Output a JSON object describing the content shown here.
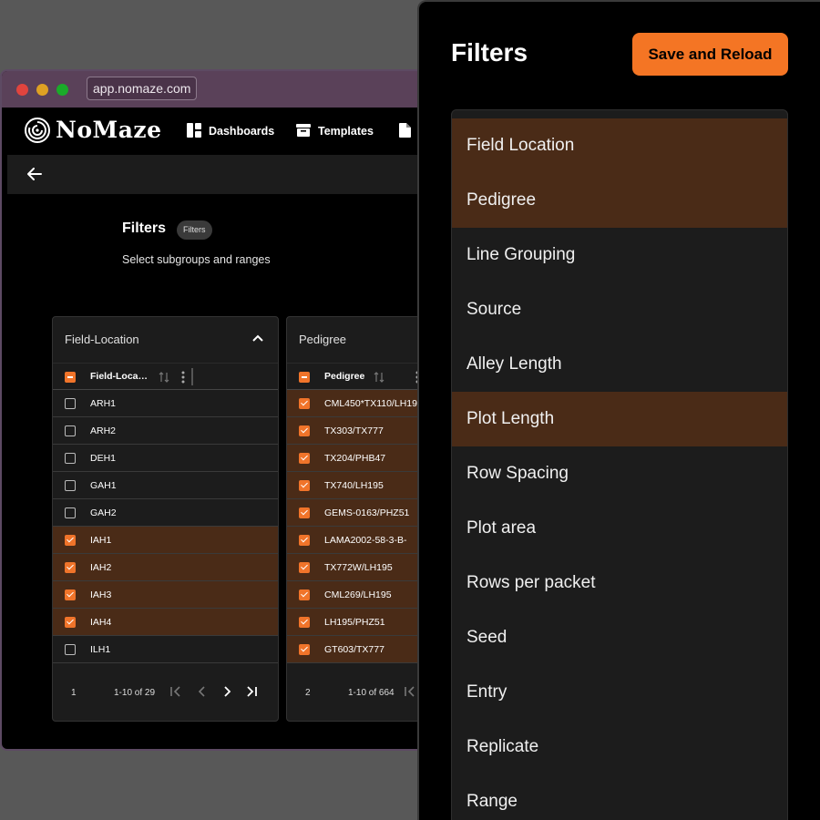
{
  "browser": {
    "url": "app.nomaze.com"
  },
  "app": {
    "brand": "NoMaze",
    "nav": {
      "dashboards": "Dashboards",
      "templates": "Templates"
    }
  },
  "page": {
    "title": "Filters",
    "badge": "Filters",
    "subtitle": "Select subgroups and ranges"
  },
  "cards": [
    {
      "title": "Field-Location",
      "column": "Field-Loca…",
      "rows": [
        {
          "label": "ARH1",
          "checked": false
        },
        {
          "label": "ARH2",
          "checked": false
        },
        {
          "label": "DEH1",
          "checked": false
        },
        {
          "label": "GAH1",
          "checked": false
        },
        {
          "label": "GAH2",
          "checked": false
        },
        {
          "label": "IAH1",
          "checked": true
        },
        {
          "label": "IAH2",
          "checked": true
        },
        {
          "label": "IAH3",
          "checked": true
        },
        {
          "label": "IAH4",
          "checked": true
        },
        {
          "label": "ILH1",
          "checked": false
        }
      ],
      "page": "1",
      "range": "1-10 of 29"
    },
    {
      "title": "Pedigree",
      "column": "Pedigree",
      "rows": [
        {
          "label": "CML450*TX110/LH19",
          "checked": true
        },
        {
          "label": "TX303/TX777",
          "checked": true
        },
        {
          "label": "TX204/PHB47",
          "checked": true
        },
        {
          "label": "TX740/LH195",
          "checked": true
        },
        {
          "label": "GEMS-0163/PHZ51",
          "checked": true
        },
        {
          "label": "LAMA2002-58-3-B-",
          "checked": true
        },
        {
          "label": "TX772W/LH195",
          "checked": true
        },
        {
          "label": "CML269/LH195",
          "checked": true
        },
        {
          "label": "LH195/PHZ51",
          "checked": true
        },
        {
          "label": "GT603/TX777",
          "checked": true
        }
      ],
      "page": "2",
      "range": "1-10 of 664"
    }
  ],
  "panel": {
    "title": "Filters",
    "save_label": "Save and Reload",
    "items": [
      {
        "label": "Field Location",
        "selected": true
      },
      {
        "label": "Pedigree",
        "selected": true
      },
      {
        "label": "Line Grouping",
        "selected": false
      },
      {
        "label": "Source",
        "selected": false
      },
      {
        "label": "Alley Length",
        "selected": false
      },
      {
        "label": "Plot Length",
        "selected": true
      },
      {
        "label": "Row Spacing",
        "selected": false
      },
      {
        "label": "Plot area",
        "selected": false
      },
      {
        "label": "Rows per packet",
        "selected": false
      },
      {
        "label": "Seed",
        "selected": false
      },
      {
        "label": "Entry",
        "selected": false
      },
      {
        "label": "Replicate",
        "selected": false
      },
      {
        "label": "Range",
        "selected": false
      }
    ]
  },
  "colors": {
    "accent": "#f47524",
    "selected_row": "#4a2b17",
    "panel_bg": "#1c1c1c"
  }
}
